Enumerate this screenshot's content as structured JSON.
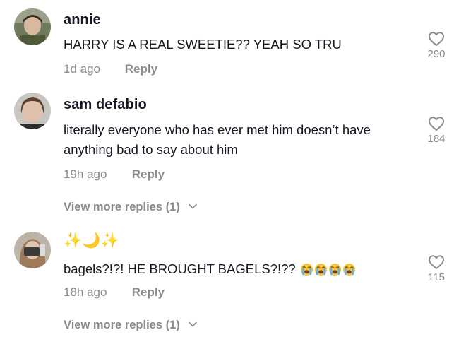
{
  "comments": [
    {
      "username": "annie",
      "text": "HARRY IS A REAL SWEETIE?? YEAH SO TRU",
      "time": "1d ago",
      "reply_label": "Reply",
      "likes": "290",
      "avatar_icon": "user-avatar"
    },
    {
      "username": "sam defabio",
      "text": "literally everyone who has ever met him doesn’t have anything bad to say about him",
      "time": "19h ago",
      "reply_label": "Reply",
      "likes": "184",
      "avatar_icon": "user-avatar",
      "view_more": "View more replies (1)"
    },
    {
      "username": "✨🌙✨",
      "text": "bagels?!?! HE BROUGHT BAGELS?!??",
      "text_emojis": [
        "loudly-crying-face",
        "loudly-crying-face",
        "loudly-crying-face",
        "loudly-crying-face"
      ],
      "time": "18h ago",
      "reply_label": "Reply",
      "likes": "115",
      "avatar_icon": "user-avatar",
      "view_more": "View more replies (1)"
    }
  ],
  "colors": {
    "text": "#161823",
    "secondary": "#8a8b91",
    "background": "#ffffff"
  }
}
